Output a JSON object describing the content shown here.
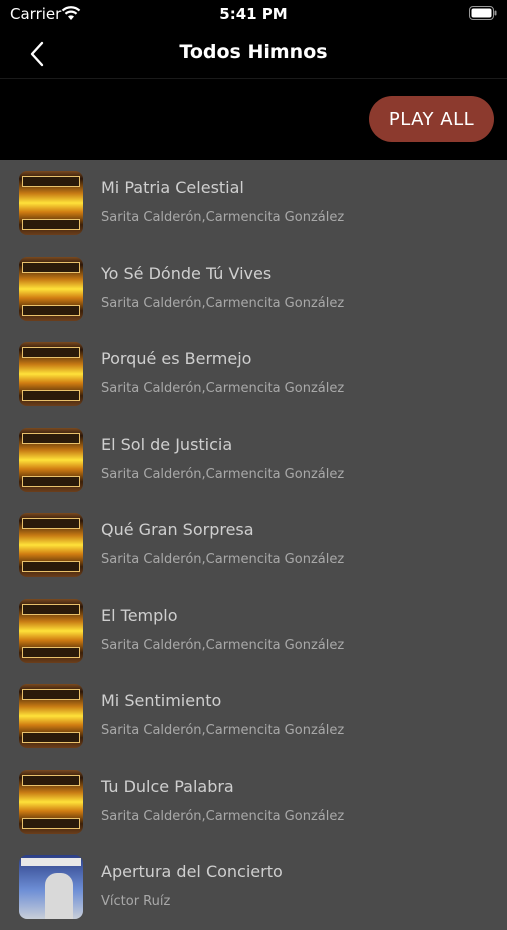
{
  "status": {
    "carrier": "Carrier",
    "time": "5:41 PM"
  },
  "nav": {
    "title": "Todos Himnos"
  },
  "toolbar": {
    "play_all_label": "PLAY ALL"
  },
  "colors": {
    "accent": "#8c3a2e",
    "background": "#4b4b4b",
    "bar": "#000000"
  },
  "songs": [
    {
      "title": "Mi Patria Celestial",
      "artist": "Sarita Calderón,Carmencita González"
    },
    {
      "title": "Yo Sé Dónde Tú Vives",
      "artist": "Sarita Calderón,Carmencita González"
    },
    {
      "title": "Porqué es Bermejo",
      "artist": "Sarita Calderón,Carmencita González"
    },
    {
      "title": "El Sol de Justicia",
      "artist": "Sarita Calderón,Carmencita González"
    },
    {
      "title": "Qué Gran Sorpresa",
      "artist": "Sarita Calderón,Carmencita González"
    },
    {
      "title": "El Templo",
      "artist": "Sarita Calderón,Carmencita González"
    },
    {
      "title": "Mi Sentimiento",
      "artist": "Sarita Calderón,Carmencita González"
    },
    {
      "title": "Tu Dulce Palabra",
      "artist": "Sarita Calderón,Carmencita González"
    },
    {
      "title": "Apertura del Concierto",
      "artist": "Víctor Ruíz"
    }
  ]
}
